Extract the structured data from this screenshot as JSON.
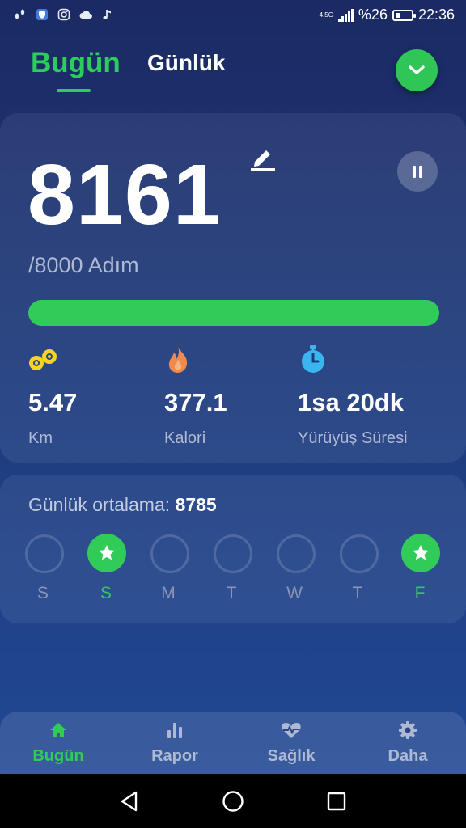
{
  "status_bar": {
    "battery_percent": "%26",
    "time": "22:36",
    "network": "4.5G",
    "icons": [
      "steps-notification-icon",
      "shield-icon",
      "instagram-icon",
      "cloud-icon",
      "music-note-icon"
    ]
  },
  "header": {
    "tab_today": "Bugün",
    "tab_daily": "Günlük",
    "dropdown_icon": "chevron-down-icon"
  },
  "summary": {
    "steps": "8161",
    "goal_text": "/8000 Adım",
    "progress": 1.0,
    "stats": [
      {
        "value": "5.47",
        "label": "Km",
        "icon": "footsteps-icon",
        "color": "#f5d327"
      },
      {
        "value": "377.1",
        "label": "Kalori",
        "icon": "flame-icon",
        "color": "#f08a4b"
      },
      {
        "value": "1sa 20dk",
        "label": "Yürüyüş Süresi",
        "icon": "stopwatch-icon",
        "color": "#3bb5f0"
      }
    ]
  },
  "weekly": {
    "avg_label": "Günlük ortalama:",
    "avg_value": "8785",
    "days": [
      {
        "label": "S",
        "achieved": false
      },
      {
        "label": "S",
        "achieved": true
      },
      {
        "label": "M",
        "achieved": false
      },
      {
        "label": "T",
        "achieved": false
      },
      {
        "label": "W",
        "achieved": false
      },
      {
        "label": "T",
        "achieved": false
      },
      {
        "label": "F",
        "achieved": true
      }
    ]
  },
  "bottom_nav": [
    {
      "label": "Bugün",
      "icon": "home-icon",
      "active": true
    },
    {
      "label": "Rapor",
      "icon": "bar-chart-icon",
      "active": false
    },
    {
      "label": "Sağlık",
      "icon": "heart-pulse-icon",
      "active": false
    },
    {
      "label": "Daha",
      "icon": "gear-icon",
      "active": false
    }
  ],
  "colors": {
    "accent": "#31cc57",
    "background_top": "#1b2a63",
    "background_bottom": "#224a97"
  }
}
